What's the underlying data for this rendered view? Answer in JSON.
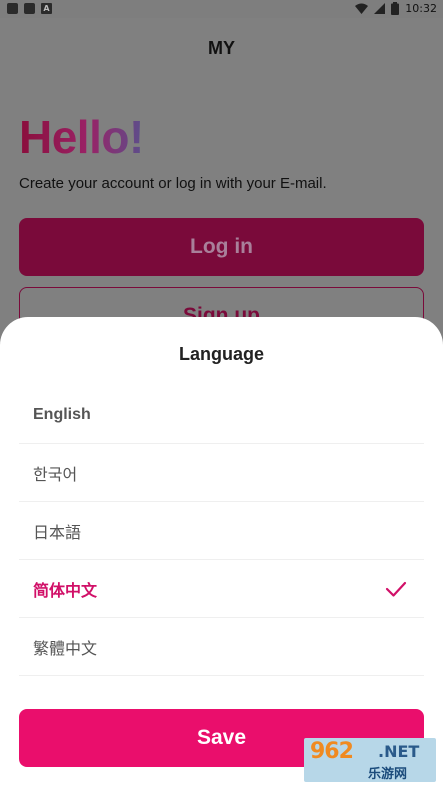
{
  "status_bar": {
    "time": "10:32",
    "left_icons": [
      "notification-square-icon",
      "notification-square-icon",
      "a-icon"
    ],
    "right_icons": [
      "wifi-icon",
      "cellular-icon",
      "battery-icon"
    ]
  },
  "background_page": {
    "app_title": "MY",
    "hello": "Hello!",
    "subtitle": "Create your account or log in with your E-mail.",
    "login_label": "Log in",
    "signup_label": "Sign up"
  },
  "sheet": {
    "title": "Language",
    "languages": [
      {
        "label": "English",
        "selected": false
      },
      {
        "label": "한국어",
        "selected": false
      },
      {
        "label": "日本語",
        "selected": false
      },
      {
        "label": "简体中文",
        "selected": true
      },
      {
        "label": "繁體中文",
        "selected": false
      }
    ],
    "selected_icon": "check-icon",
    "save_label": "Save"
  },
  "watermark": {
    "text_top": "962",
    "text_net": ".NET",
    "text_bottom": "乐游网"
  },
  "colors": {
    "accent": "#ea0e6c",
    "selected_text": "#d11068",
    "dim_overlay": "#808080"
  }
}
